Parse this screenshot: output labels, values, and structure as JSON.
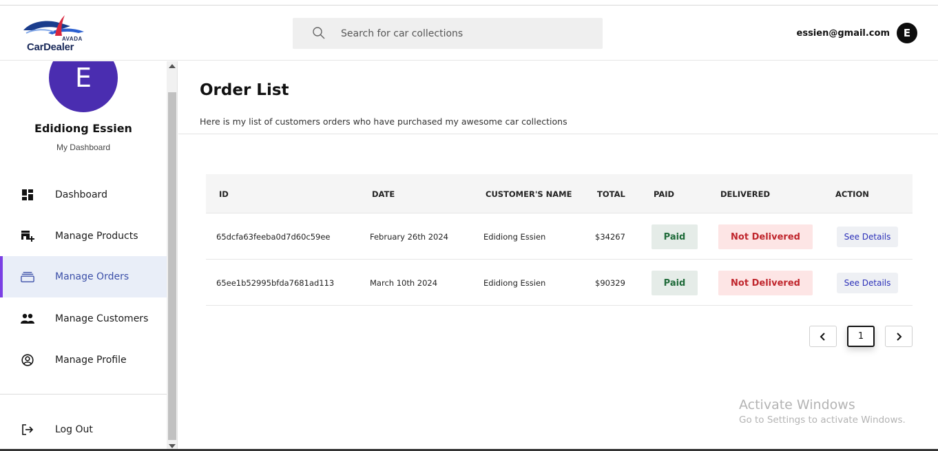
{
  "header": {
    "logo_small": "AVADA",
    "logo_text": "CarDealer",
    "search_placeholder": "Search for car collections",
    "user_email": "essien@gmail.com",
    "user_initial": "E"
  },
  "sidebar": {
    "avatar_initial": "E",
    "profile_name": "Edidiong Essien",
    "profile_subtitle": "My Dashboard",
    "items": [
      {
        "label": "Dashboard",
        "icon": "dashboard-icon",
        "active": false
      },
      {
        "label": "Manage Products",
        "icon": "add-product-icon",
        "active": false
      },
      {
        "label": "Manage Orders",
        "icon": "orders-icon",
        "active": true
      },
      {
        "label": "Manage Customers",
        "icon": "customers-icon",
        "active": false
      },
      {
        "label": "Manage Profile",
        "icon": "profile-icon",
        "active": false
      }
    ],
    "logout_label": "Log Out",
    "active_color": "#7b3fe4"
  },
  "main": {
    "title": "Order List",
    "description": "Here is my list of customers orders who have purchased my awesome car collections",
    "table": {
      "columns": [
        "ID",
        "DATE",
        "CUSTOMER'S NAME",
        "TOTAL",
        "PAID",
        "DELIVERED",
        "ACTION"
      ],
      "rows": [
        {
          "id": "65dcfa63feeba0d7d60c59ee",
          "date": "February 26th 2024",
          "customer": "Edidiong Essien",
          "total": "$34267",
          "paid": "Paid",
          "delivered": "Not Delivered",
          "action": "See Details"
        },
        {
          "id": "65ee1b52995bfda7681ad113",
          "date": "March 10th 2024",
          "customer": "Edidiong Essien",
          "total": "$90329",
          "paid": "Paid",
          "delivered": "Not Delivered",
          "action": "See Details"
        }
      ]
    },
    "pagination": {
      "current_page": "1"
    }
  },
  "watermark": {
    "title": "Activate Windows",
    "subtitle": "Go to Settings to activate Windows."
  }
}
